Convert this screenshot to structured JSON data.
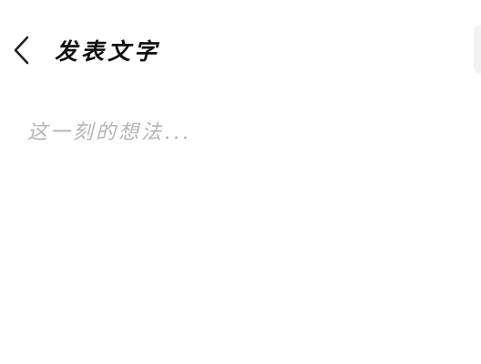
{
  "header": {
    "title": "发表文字",
    "back_icon": "chevron-left-icon",
    "publish_label": ""
  },
  "editor": {
    "placeholder": "这一刻的想法...",
    "value": ""
  },
  "colors": {
    "background": "#ffffff",
    "title": "#111111",
    "placeholder": "#b4b4b4",
    "publish_button": "#f2f2f2"
  }
}
